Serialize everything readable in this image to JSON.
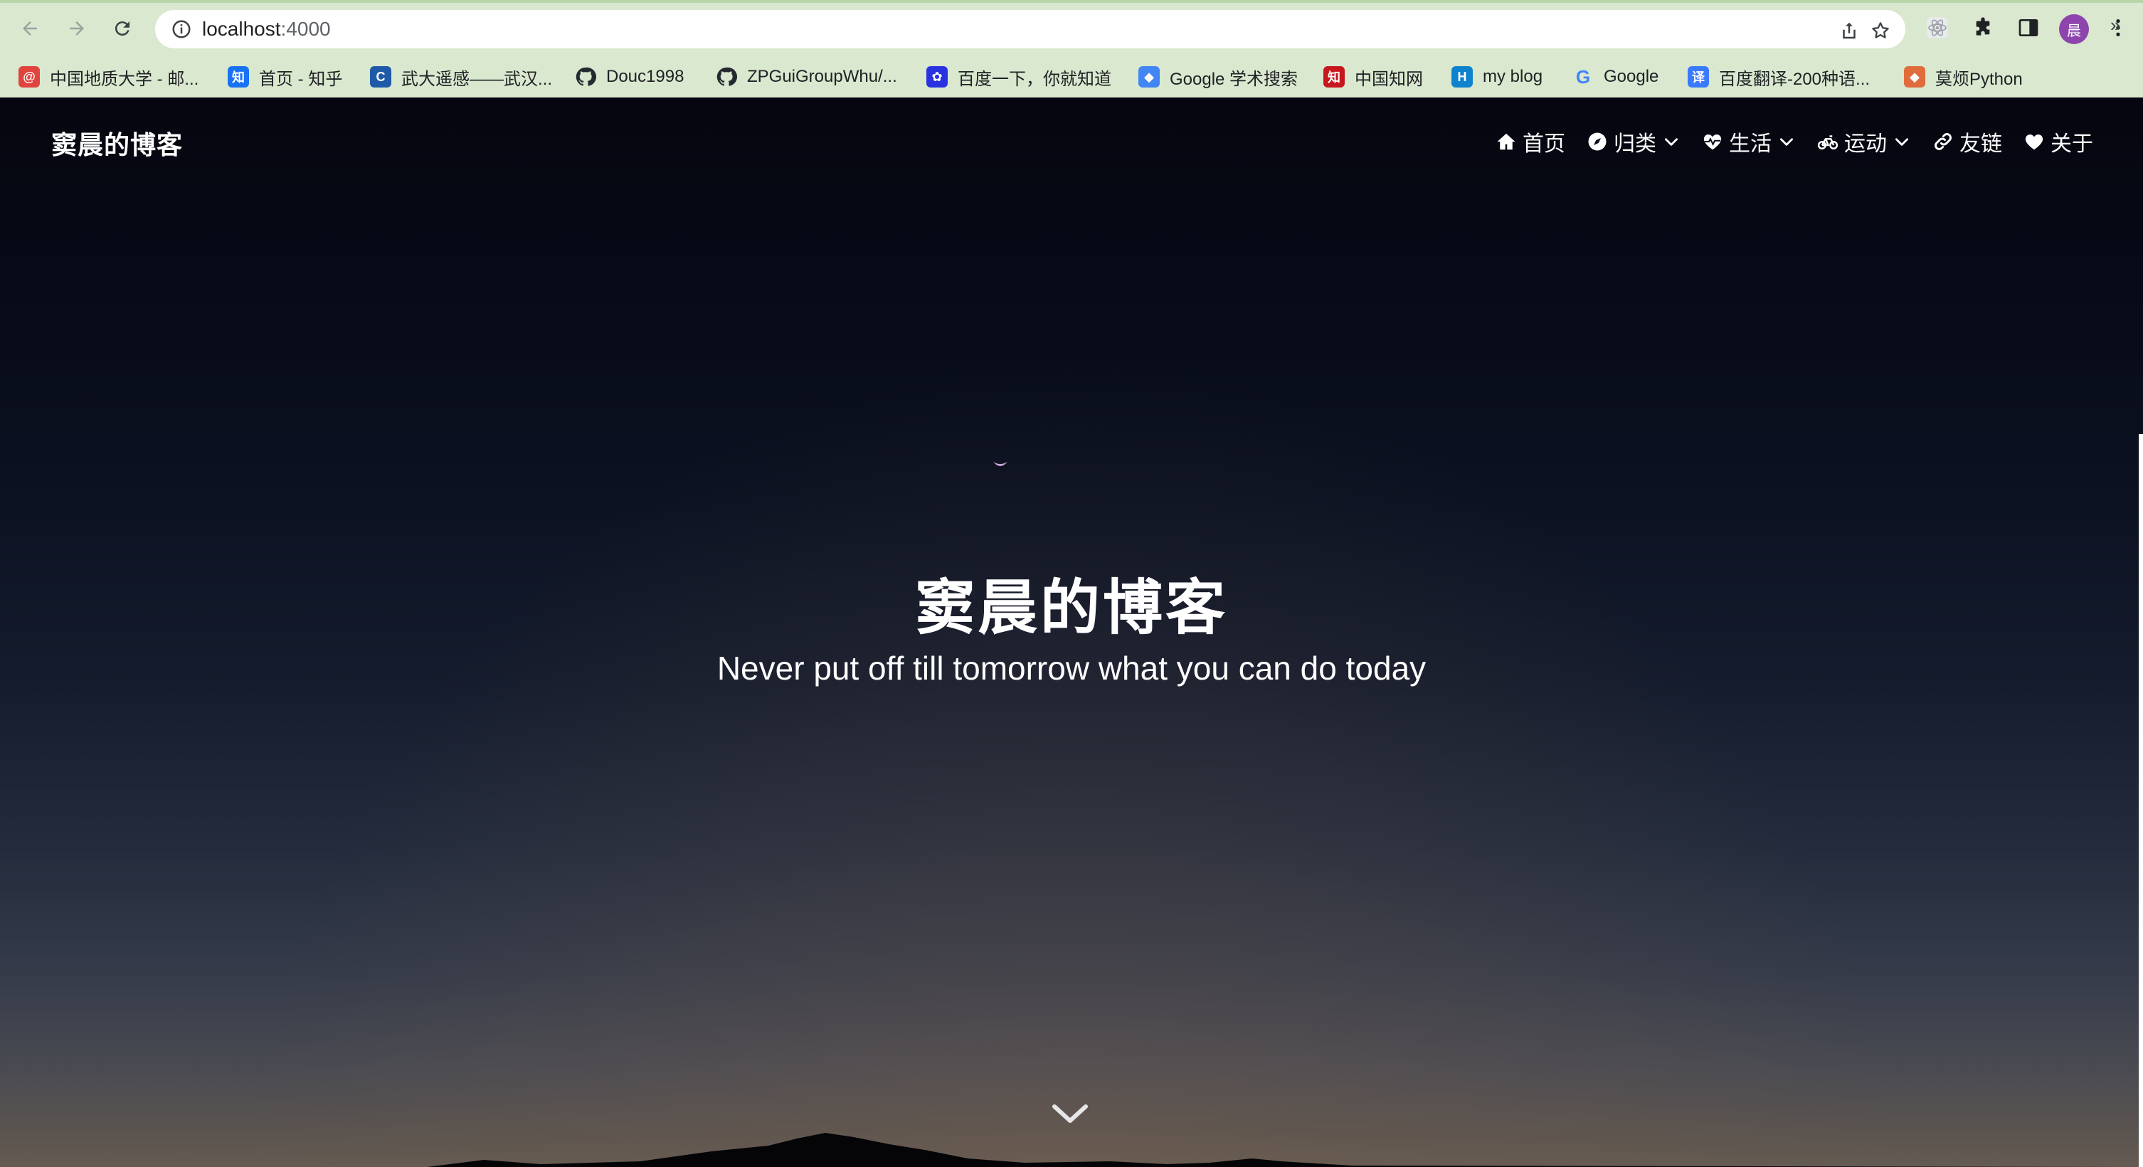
{
  "browser": {
    "url_host": "localhost",
    "url_port": ":4000",
    "profile_initial": "晨",
    "bookmarks": [
      {
        "label": "中国地质大学 - 邮...",
        "icon": "mail-icon",
        "icon_glyph": "@",
        "color": "#e0443e"
      },
      {
        "label": "首页 - 知乎",
        "icon": "zhihu-icon",
        "icon_glyph": "知",
        "color": "#1772f6"
      },
      {
        "label": "武大遥感——武汉...",
        "icon": "whu-icon",
        "icon_glyph": "C",
        "color": "#1e5aa8"
      },
      {
        "label": "Douc1998",
        "icon": "github-icon",
        "icon_glyph": "",
        "color": "#24292f"
      },
      {
        "label": "ZPGuiGroupWhu/...",
        "icon": "github-icon",
        "icon_glyph": "",
        "color": "#24292f"
      },
      {
        "label": "百度一下，你就知道",
        "icon": "baidu-icon",
        "icon_glyph": "✿",
        "color": "#2932e1"
      },
      {
        "label": "Google 学术搜索",
        "icon": "scholar-icon",
        "icon_glyph": "◆",
        "color": "#4285f4"
      },
      {
        "label": "中国知网",
        "icon": "cnki-icon",
        "icon_glyph": "知",
        "color": "#c8161d"
      },
      {
        "label": "my blog",
        "icon": "hexo-icon",
        "icon_glyph": "H",
        "color": "#0e83cd"
      },
      {
        "label": "Google",
        "icon": "google-icon",
        "icon_glyph": "G",
        "color": "#ffffff"
      },
      {
        "label": "百度翻译-200种语...",
        "icon": "baidu-translate-icon",
        "icon_glyph": "译",
        "color": "#3a7afe"
      },
      {
        "label": "莫烦Python",
        "icon": "mofan-icon",
        "icon_glyph": "◆",
        "color": "#e06c3c"
      }
    ],
    "more_label": "»"
  },
  "site": {
    "brand": "窦晨的博客",
    "nav": [
      {
        "label": "首页",
        "icon": "home-icon",
        "dropdown": false
      },
      {
        "label": "归类",
        "icon": "compass-icon",
        "dropdown": true
      },
      {
        "label": "生活",
        "icon": "heartbeat-icon",
        "dropdown": true
      },
      {
        "label": "运动",
        "icon": "bicycle-icon",
        "dropdown": true
      },
      {
        "label": "友链",
        "icon": "link-icon",
        "dropdown": false
      },
      {
        "label": "关于",
        "icon": "heart-icon",
        "dropdown": false
      }
    ],
    "hero": {
      "title": "窦晨的博客",
      "subtitle": "Never put off till tomorrow what you can do today"
    }
  }
}
